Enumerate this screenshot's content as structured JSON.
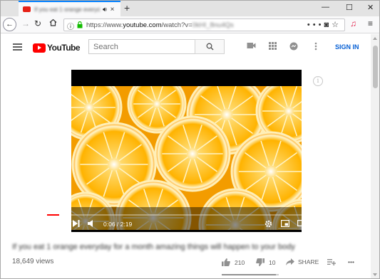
{
  "browser": {
    "tab": {
      "title": "If you eat 1 orange everyday for a month",
      "audio_icon": "speaker-icon",
      "close": "×"
    },
    "new_tab": "+",
    "window_controls": {
      "minimize": "—",
      "maximize": "☐",
      "close": "✕"
    },
    "url_prefix": "https://www.",
    "url_domain": "youtube.com",
    "url_path": "/watch?v=",
    "url_id": "0kHI_8nu4Qs",
    "menu": "≡"
  },
  "youtube": {
    "logo": "YouTube",
    "search": {
      "placeholder": "Search"
    },
    "sign_in": "SIGN IN",
    "accent": "#ff0000",
    "link_color": "#065fd4"
  },
  "player": {
    "current_time": "0:06",
    "duration": "2:19",
    "time_display": "0:06 / 2:19",
    "progress_fraction": 0.043
  },
  "video": {
    "title": "If you eat 1 orange everyday for a month amazing things will happen to your body",
    "views": "18,649 views",
    "likes": "210",
    "dislikes": "10",
    "share": "SHARE",
    "more": "•••",
    "like_ratio": 0.95
  }
}
